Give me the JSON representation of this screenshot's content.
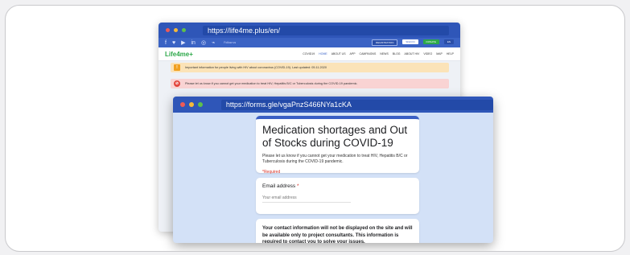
{
  "back_window": {
    "url": "https://life4me.plus/en/",
    "social_follow": "Follow us",
    "buttons": [
      "REGISTRATION",
      "SIGN IN",
      "DONATE",
      "EN"
    ],
    "logo_main": "Life4me",
    "logo_plus": "+",
    "nav": [
      "COVID19",
      "HOME",
      "ABOUT US",
      "APP",
      "CAMPAIGNS",
      "NEWS",
      "BLOG",
      "ABOUT HIV",
      "VIDEO",
      "MAP",
      "HELP"
    ],
    "alert_info": "Important information for people living with HIV about coronavirus (COVID-19). Last updated: 05.11.2020",
    "alert_warning": "Please let us know if you cannot get your medication to treat HIV, Hepatitis B/C or Tuberculosis during the COVID-19 pandemic."
  },
  "front_window": {
    "url": "https://forms.gle/vgaPnzS466NYa1cKA",
    "form_title": "Medication shortages and Out of Stocks during COVID-19",
    "form_description": "Please let us know if you cannot get your medication to treat HIV, Hepatitis B/C or Tuberculosis during the COVID-19 pandemic.",
    "required_note": "*Required",
    "email_label": "Email address",
    "email_required_mark": "*",
    "email_placeholder": "Your email address",
    "info_text": "Your contact information will not be displayed on the site and will be available only to project consultants. This information is required to contact you to solve your issues."
  },
  "colors": {
    "titlebar": "#2f56b8",
    "dot_red": "#ee5b57",
    "dot_yellow": "#f5b93a",
    "dot_green": "#5fc04a",
    "alert_info_bg": "#fbe3b8",
    "alert_warning_bg": "#f9d3d3",
    "required": "#d93025"
  },
  "icons": [
    "facebook-icon",
    "twitter-icon",
    "youtube-icon",
    "linkedin-icon",
    "instagram-icon",
    "rss-icon",
    "warning-icon",
    "stop-icon"
  ]
}
